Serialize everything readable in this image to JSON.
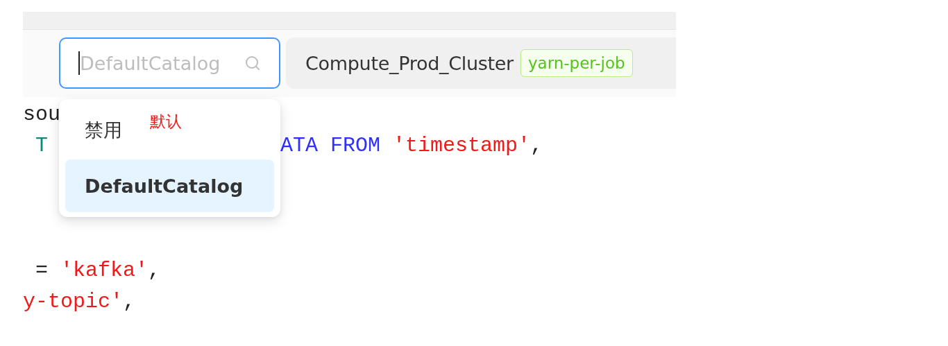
{
  "catalog_select": {
    "placeholder": "DefaultCatalog",
    "focused": true,
    "options": [
      {
        "label": "禁用",
        "selected": false,
        "annotation": "默认"
      },
      {
        "label": "DefaultCatalog",
        "selected": true
      }
    ]
  },
  "cluster": {
    "name": "Compute_Prod_Cluster",
    "tag": "yarn-per-job"
  },
  "code_lines": [
    {
      "kind": "code",
      "left": [
        {
          "text": "sou",
          "kind": "plain"
        }
      ]
    },
    {
      "kind": "code",
      "left": [
        {
          "text": " T",
          "kind": "type"
        }
      ],
      "right": [
        {
          "text": "ATA FROM ",
          "kind": "keyword"
        },
        {
          "text": "'timestamp'",
          "kind": "string"
        },
        {
          "text": ",",
          "kind": "plain"
        }
      ]
    },
    {
      "kind": "blank"
    },
    {
      "kind": "blank"
    },
    {
      "kind": "blank"
    },
    {
      "kind": "code",
      "left": [
        {
          "text": " = ",
          "kind": "plain"
        },
        {
          "text": "'kafka'",
          "kind": "string"
        },
        {
          "text": ",",
          "kind": "plain"
        }
      ]
    },
    {
      "kind": "code",
      "left": [
        {
          "text": "y-topic'",
          "kind": "string"
        },
        {
          "text": ",",
          "kind": "plain"
        }
      ]
    }
  ]
}
